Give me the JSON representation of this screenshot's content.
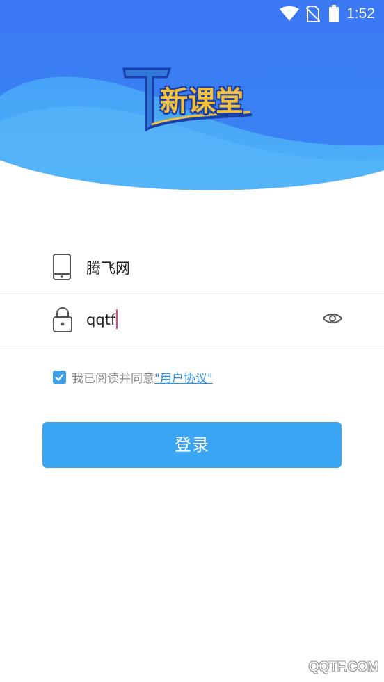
{
  "status_bar": {
    "time": "1:52",
    "icons": [
      "wifi-icon",
      "no-sim-icon",
      "battery-icon"
    ]
  },
  "app": {
    "logo_text": "新课堂",
    "logo_letter": "T"
  },
  "login_form": {
    "account_value": "腾飞网",
    "password_value": "qqtf",
    "agreement_prefix": "我已阅读并同意",
    "agreement_link": "\"用户协议\"",
    "agreement_checked": true,
    "login_label": "登录"
  },
  "watermark": "QQTF.COM",
  "colors": {
    "header_blue": "#3a7cf2",
    "wave_light": "#45aaf6",
    "button_blue": "#3aa5f3",
    "link_blue": "#2f8ee0"
  }
}
